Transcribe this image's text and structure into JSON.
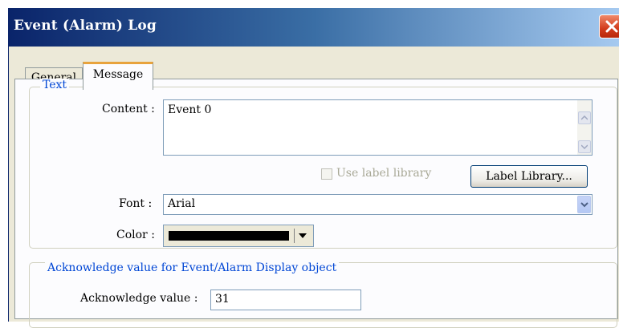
{
  "window": {
    "title": "Event (Alarm) Log"
  },
  "tabs": [
    {
      "label": "General",
      "selected": false
    },
    {
      "label": "Message",
      "selected": true
    }
  ],
  "text_group": {
    "legend": "Text",
    "content_label": "Content :",
    "content_value": "Event 0",
    "use_label_library_label": "Use label library",
    "use_label_library_checked": false,
    "label_library_button": "Label Library...",
    "font_label": "Font :",
    "font_value": "Arial",
    "color_label": "Color :",
    "color_value": "#000000"
  },
  "ack_group": {
    "legend": "Acknowledge value for Event/Alarm Display object",
    "value_label": "Acknowledge value :",
    "value": "31"
  },
  "colors": {
    "title_bar_start": "#0a246a",
    "title_bar_end": "#a6caf0",
    "selected_tab_accent": "#e8a33c",
    "group_legend": "#0046d5",
    "close_button": "#d23c1c"
  },
  "icons": {
    "close": "close-icon",
    "scroll_up": "chevron-up-icon",
    "scroll_down": "chevron-down-icon",
    "dropdown": "chevron-down-icon"
  }
}
